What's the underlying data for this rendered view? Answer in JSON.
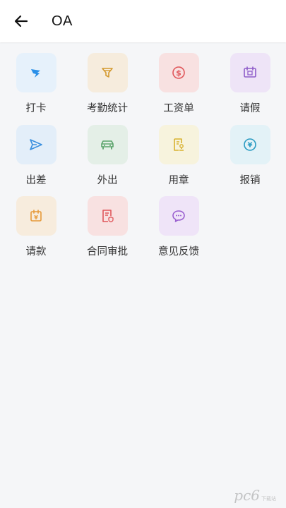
{
  "header": {
    "title": "OA"
  },
  "tiles": [
    {
      "label": "打卡",
      "icon": "check-in-icon",
      "color": "#2b90e8",
      "bg": "#e6f1fb"
    },
    {
      "label": "考勤统计",
      "icon": "funnel-icon",
      "color": "#d49a2f",
      "bg": "#f6ecdd"
    },
    {
      "label": "工资单",
      "icon": "salary-icon",
      "color": "#e0575b",
      "bg": "#f8e1e1"
    },
    {
      "label": "请假",
      "icon": "calendar-leave-icon",
      "color": "#8e5cc9",
      "bg": "#eee4f7"
    },
    {
      "label": "出差",
      "icon": "send-icon",
      "color": "#3a8fde",
      "bg": "#e3eef9"
    },
    {
      "label": "外出",
      "icon": "car-icon",
      "color": "#5aa36a",
      "bg": "#e4efe7"
    },
    {
      "label": "用章",
      "icon": "seal-icon",
      "color": "#d8b12f",
      "bg": "#f7f3dd"
    },
    {
      "label": "报销",
      "icon": "reimburse-icon",
      "color": "#2a9bc2",
      "bg": "#e3f2f7"
    },
    {
      "label": "请款",
      "icon": "payment-request-icon",
      "color": "#e69a3a",
      "bg": "#f7ecdd"
    },
    {
      "label": "合同审批",
      "icon": "contract-icon",
      "color": "#e0575b",
      "bg": "#f8e1e1"
    },
    {
      "label": "意见反馈",
      "icon": "feedback-icon",
      "color": "#9a5fd0",
      "bg": "#efe4f8"
    }
  ],
  "watermark": {
    "main": "pc6",
    "sub": "下载站"
  }
}
